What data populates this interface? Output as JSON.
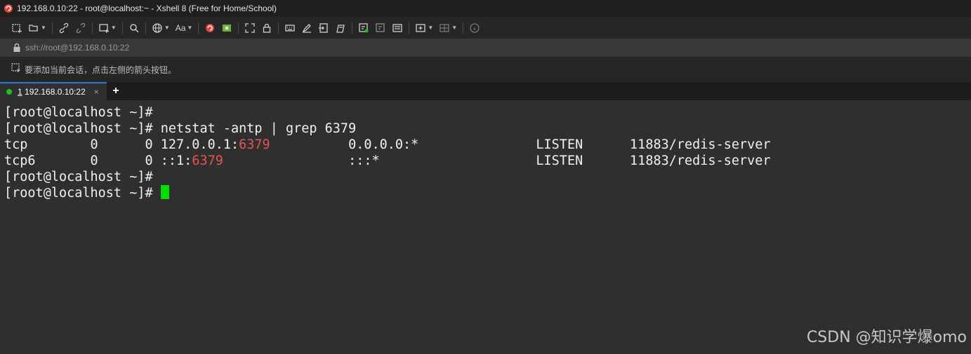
{
  "window": {
    "title": "192.168.0.10:22 - root@localhost:~ - Xshell 8 (Free for Home/School)"
  },
  "address": {
    "url": "ssh://root@192.168.0.10:22"
  },
  "session_bar": {
    "hint": "要添加当前会话，点击左侧的箭头按钮。"
  },
  "tabs": [
    {
      "index": "1",
      "label": "192.168.0.10:22",
      "close": "×",
      "status_color": "#19c319"
    }
  ],
  "new_tab": "+",
  "toolbar": {
    "font_label": "Aa",
    "icons": [
      "new-session-icon",
      "open-folder-icon",
      "reconnect-icon",
      "disconnect-icon",
      "new-tab-icon",
      "search-icon",
      "globe-icon",
      "font-icon",
      "xshell-icon",
      "xftp-icon",
      "fullscreen-icon",
      "lock-icon",
      "keyboard-icon",
      "highlight-icon",
      "script-icon",
      "transfer-icon",
      "compose-icon",
      "compose-all-icon",
      "compose-bar-icon",
      "add-tab-icon",
      "layout-icon",
      "help-icon"
    ]
  },
  "terminal": {
    "lines": [
      {
        "text": "[root@localhost ~]# "
      },
      {
        "text": "[root@localhost ~]# netstat -antp | grep 6379"
      },
      {
        "pre": "tcp        0      0 127.0.0.1:",
        "hl": "6379",
        "post": "          0.0.0.0:*               LISTEN      11883/redis-server"
      },
      {
        "pre": "tcp6       0      0 ::1:",
        "hl": "6379",
        "post": "                :::*                    LISTEN      11883/redis-server"
      },
      {
        "text": "[root@localhost ~]# "
      },
      {
        "text": "[root@localhost ~]# "
      }
    ],
    "highlight_color": "#e55353",
    "cursor_color": "#00e000"
  },
  "watermark": "CSDN @知识学爆omo"
}
